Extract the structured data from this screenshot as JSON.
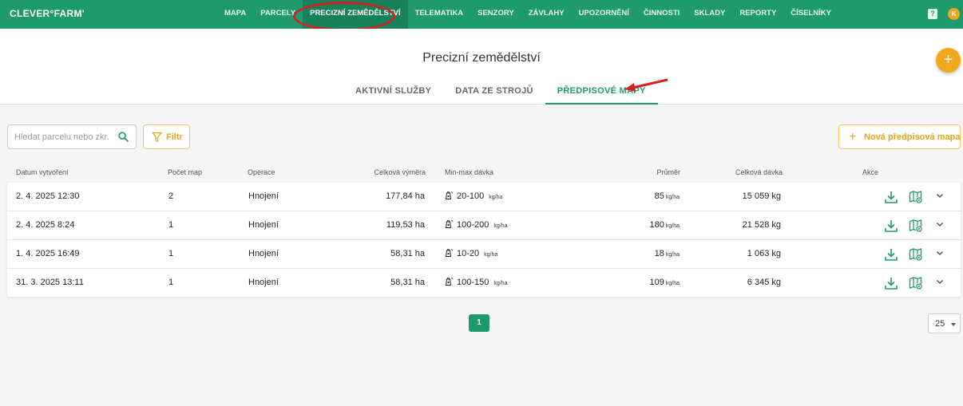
{
  "app": {
    "logo": "CLEVER°FARM'",
    "nav": [
      {
        "label": "MAPA",
        "active": false
      },
      {
        "label": "PARCELY",
        "active": false
      },
      {
        "label": "PRECIZNÍ ZEMĚDĚLSTVÍ",
        "active": true
      },
      {
        "label": "TELEMATIKA",
        "active": false
      },
      {
        "label": "SENZORY",
        "active": false
      },
      {
        "label": "ZÁVLAHY",
        "active": false
      },
      {
        "label": "UPOZORNĚNÍ",
        "active": false
      },
      {
        "label": "ČINNOSTI",
        "active": false
      },
      {
        "label": "SKLADY",
        "active": false
      },
      {
        "label": "REPORTY",
        "active": false
      },
      {
        "label": "ČÍSELNÍKY",
        "active": false
      }
    ],
    "help_icon": "?",
    "user_initial": "K"
  },
  "header": {
    "title": "Precizní zemědělství",
    "fab_icon": "+",
    "tabs": [
      {
        "label": "AKTIVNÍ SLUŽBY",
        "active": false
      },
      {
        "label": "DATA ZE STROJŮ",
        "active": false
      },
      {
        "label": "PŘEDPISOVÉ MAPY",
        "active": true
      }
    ]
  },
  "toolbar": {
    "search_placeholder": "Hledat parcelu nebo zkr. blok",
    "filter_label": "Filtr",
    "new_map_label": "Nová předpisová mapa",
    "plus": "+"
  },
  "table": {
    "headers": {
      "created": "Datum vytvoření",
      "map_count": "Počet map",
      "operation": "Operace",
      "area": "Celková výměra",
      "dose_range": "Min-max dávka",
      "average": "Průměr",
      "total_dose": "Celková dávka",
      "actions": "Akce"
    },
    "rows": [
      {
        "created": "2. 4. 2025 12:30",
        "map_count": "2",
        "operation": "Hnojení",
        "area": "177,84 ha",
        "dose_range": "20-100",
        "dose_unit": "kg/ha",
        "average": "85",
        "avg_unit": "kg/ha",
        "total": "15 059 kg"
      },
      {
        "created": "2. 4. 2025 8:24",
        "map_count": "1",
        "operation": "Hnojení",
        "area": "119,53 ha",
        "dose_range": "100-200",
        "dose_unit": "kg/ha",
        "average": "180",
        "avg_unit": "kg/ha",
        "total": "21 528 kg"
      },
      {
        "created": "1. 4. 2025 16:49",
        "map_count": "1",
        "operation": "Hnojení",
        "area": "58,31 ha",
        "dose_range": "10-20",
        "dose_unit": "kg/ha",
        "average": "18",
        "avg_unit": "kg/ha",
        "total": "1 063 kg"
      },
      {
        "created": "31. 3. 2025 13:11",
        "map_count": "1",
        "operation": "Hnojení",
        "area": "58,31 ha",
        "dose_range": "100-150",
        "dose_unit": "kg/ha",
        "average": "109",
        "avg_unit": "kg/ha",
        "total": "6 345 kg"
      }
    ]
  },
  "pagination": {
    "current_page": "1",
    "per_page": "25"
  },
  "colors": {
    "brand": "#1f9a6c",
    "accent": "#f0a81c",
    "annotation": "#d62020"
  }
}
